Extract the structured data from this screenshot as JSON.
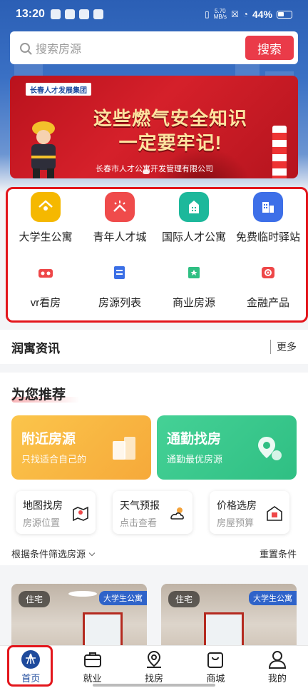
{
  "status_bar": {
    "time": "13:20",
    "net_speed": "5.70",
    "net_unit": "MB/s",
    "battery": "44%"
  },
  "search": {
    "placeholder": "搜索房源",
    "button": "搜索"
  },
  "banner": {
    "logo": "长春人才发展集团",
    "line1": "这些燃气安全知识",
    "line2": "一定要牢记!",
    "company": "长春市人才公寓开发管理有限公司"
  },
  "quick_links": [
    {
      "label": "大学生公寓",
      "icon": "house-icon",
      "color": "#f5b800"
    },
    {
      "label": "青年人才城",
      "icon": "sunrise-icon",
      "color": "#ef4b4b"
    },
    {
      "label": "国际人才公寓",
      "icon": "building-icon",
      "color": "#1db89b"
    },
    {
      "label": "免费临时驿站",
      "icon": "city-icon",
      "color": "#3d6fe8"
    },
    {
      "label": "vr看房",
      "icon": "vr-icon",
      "color": "#ee4748"
    },
    {
      "label": "房源列表",
      "icon": "list-icon",
      "color": "#3b6fe6"
    },
    {
      "label": "商业房源",
      "icon": "shop-icon",
      "color": "#2fbf83"
    },
    {
      "label": "金融产品",
      "icon": "finance-icon",
      "color": "#ee4748"
    }
  ],
  "news": {
    "title": "润寓资讯",
    "more": "更多"
  },
  "recommend": {
    "title": "为您推荐",
    "big_cards": [
      {
        "title": "附近房源",
        "subtitle": "只找适合自己的"
      },
      {
        "title": "通勤找房",
        "subtitle": "通勤最优房源"
      }
    ],
    "small_cards": [
      {
        "title": "地图找房",
        "subtitle": "房源位置"
      },
      {
        "title": "天气预报",
        "subtitle": "点击查看"
      },
      {
        "title": "价格选房",
        "subtitle": "房屋预算"
      }
    ],
    "filter_label": "根据条件筛选房源",
    "reset_label": "重置条件"
  },
  "listings": [
    {
      "tag": "住宅",
      "badge": "大学生公寓"
    },
    {
      "tag": "住宅",
      "badge": "大学生公寓"
    }
  ],
  "bottom_nav": [
    {
      "label": "首页",
      "icon": "home-icon"
    },
    {
      "label": "就业",
      "icon": "briefcase-icon"
    },
    {
      "label": "找房",
      "icon": "map-pin-icon"
    },
    {
      "label": "商城",
      "icon": "shopping-bag-icon"
    },
    {
      "label": "我的",
      "icon": "user-icon"
    }
  ]
}
